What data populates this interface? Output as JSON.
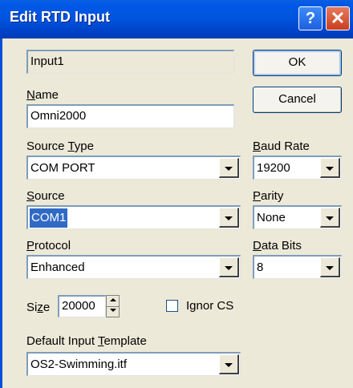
{
  "window": {
    "title": "Edit RTD Input",
    "help_glyph": "?",
    "close_glyph": "✕"
  },
  "input_id": "Input1",
  "name": {
    "label_u": "N",
    "label_rest": "ame",
    "value": "Omni2000"
  },
  "source_type": {
    "label_pre": "Source ",
    "label_u": "T",
    "label_rest": "ype",
    "value": "COM PORT"
  },
  "source": {
    "label_u": "S",
    "label_rest": "ource",
    "value": "COM1"
  },
  "protocol": {
    "label_u": "P",
    "label_rest": "rotocol",
    "value": "Enhanced"
  },
  "size": {
    "label_pre": "Si",
    "label_u": "z",
    "label_rest": "e",
    "value": "20000"
  },
  "ignore_cs": {
    "label": "Ignor CS",
    "checked": false
  },
  "template": {
    "label_pre": "Default Input ",
    "label_u": "T",
    "label_rest": "emplate",
    "value": "OS2-Swimming.itf"
  },
  "buttons": {
    "ok": "OK",
    "cancel": "Cancel"
  },
  "baud_rate": {
    "label_u": "B",
    "label_rest": "aud Rate",
    "value": "19200"
  },
  "parity": {
    "label_u": "P",
    "label_rest": "arity",
    "value": "None"
  },
  "data_bits": {
    "label_u": "D",
    "label_rest": "ata Bits",
    "value": "8"
  },
  "colors": {
    "titlebar": "#0054dd",
    "dialog_bg": "#ece9d8",
    "selection": "#316ac5"
  }
}
